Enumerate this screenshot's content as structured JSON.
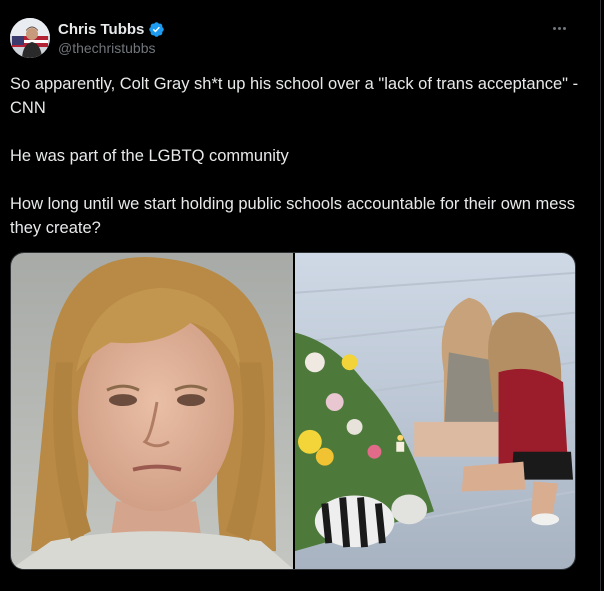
{
  "tweet": {
    "author": {
      "display_name": "Chris Tubbs",
      "handle": "@thechristubbs",
      "verified": true,
      "avatar_icon": "user-avatar"
    },
    "menu_icon": "more-horizontal-icon",
    "paragraphs": [
      "So apparently, Colt Gray sh*t up his school over a \"lack of trans acceptance\" - CNN",
      "He was part of the LGBTQ community",
      "How long until we start holding public schools accountable for their own mess they create?"
    ],
    "media": [
      {
        "kind": "photo",
        "icon": "mugshot-photo"
      },
      {
        "kind": "photo",
        "icon": "memorial-photo"
      }
    ]
  },
  "colors": {
    "background": "#000000",
    "text_primary": "#e7e9ea",
    "text_secondary": "#71767b",
    "verified_badge": "#1d9bf0",
    "border": "#2f3336"
  }
}
